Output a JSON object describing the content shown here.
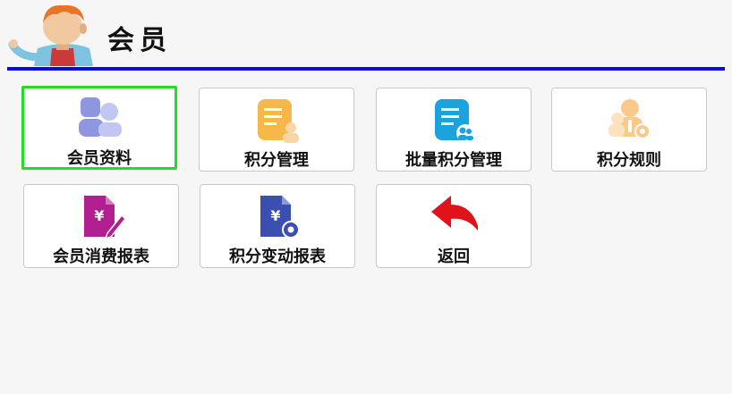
{
  "header": {
    "title": "会员",
    "avatar_icon": "person-waving-icon"
  },
  "colors": {
    "accent_line": "#0a0ae0",
    "selected_border": "#22dd22"
  },
  "tiles": [
    {
      "label": "会员资料",
      "icon": "members-icon",
      "selected": true
    },
    {
      "label": "积分管理",
      "icon": "points-document-person-icon"
    },
    {
      "label": "批量积分管理",
      "icon": "batch-points-document-icon"
    },
    {
      "label": "积分规则",
      "icon": "points-rules-gear-icon"
    },
    {
      "label": "会员消费报表",
      "icon": "yuan-document-pen-icon"
    },
    {
      "label": "积分变动报表",
      "icon": "yuan-document-gear-icon"
    },
    {
      "label": "返回",
      "icon": "return-arrow-icon"
    }
  ]
}
